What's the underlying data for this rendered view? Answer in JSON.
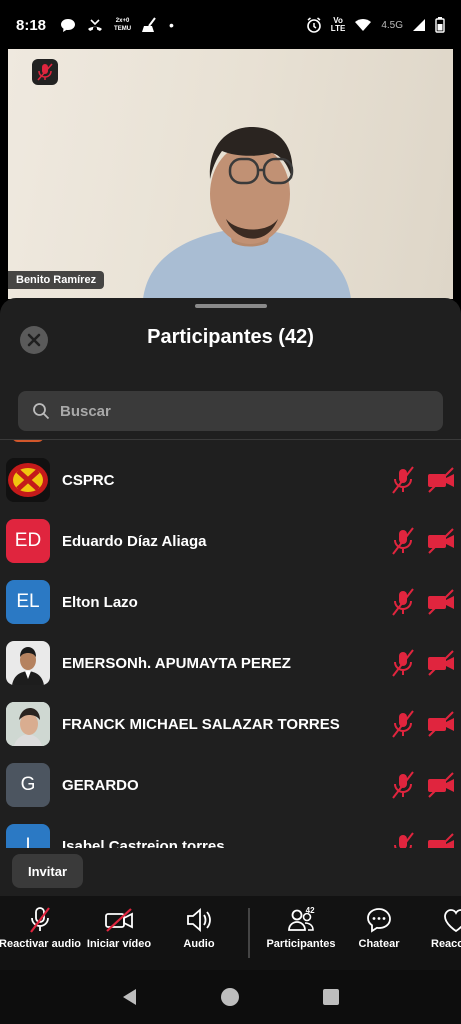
{
  "status_bar": {
    "time": "8:18",
    "net_tiny_1": "Vo",
    "net_tiny_2": "LTE",
    "net_type": "4.5G"
  },
  "video": {
    "speaker_name": "Benito Ramírez"
  },
  "panel": {
    "title": "Participantes (42)",
    "search_placeholder": "Buscar",
    "participants": [
      {
        "name": "CSPRC",
        "avatar_kind": "logo"
      },
      {
        "name": "Eduardo Díaz Aliaga",
        "initials": "ED",
        "avatar_color": "#e0253e"
      },
      {
        "name": "Elton Lazo",
        "initials": "EL",
        "avatar_color": "#2b79c4"
      },
      {
        "name": "EMERSONh. APUMAYTA PEREZ",
        "avatar_kind": "photo"
      },
      {
        "name": "FRANCK MICHAEL SALAZAR TORRES",
        "avatar_kind": "photo"
      },
      {
        "name": "GERARDO",
        "initials": "G",
        "avatar_color": "#4c5560"
      },
      {
        "name": "Isabel Castrejon torres",
        "initials": "I",
        "avatar_color": "#2b79c4"
      }
    ],
    "invite_label": "Invitar"
  },
  "toolbar": {
    "unmute_label": "Reactivar audio",
    "start_video_label": "Iniciar vídeo",
    "audio_label": "Audio",
    "participants_label": "Participantes",
    "participants_count": "42",
    "chat_label": "Chatear",
    "reactions_label": "Reacciones"
  },
  "colors": {
    "muted_red": "#e0253e",
    "sheet_bg": "#1f1f1f",
    "toolbar_bg": "#121212"
  },
  "icons": [
    "close-icon",
    "search-icon",
    "mic-muted-icon",
    "video-off-icon",
    "audio-icon",
    "participants-icon",
    "chat-icon",
    "reaction-icon"
  ]
}
